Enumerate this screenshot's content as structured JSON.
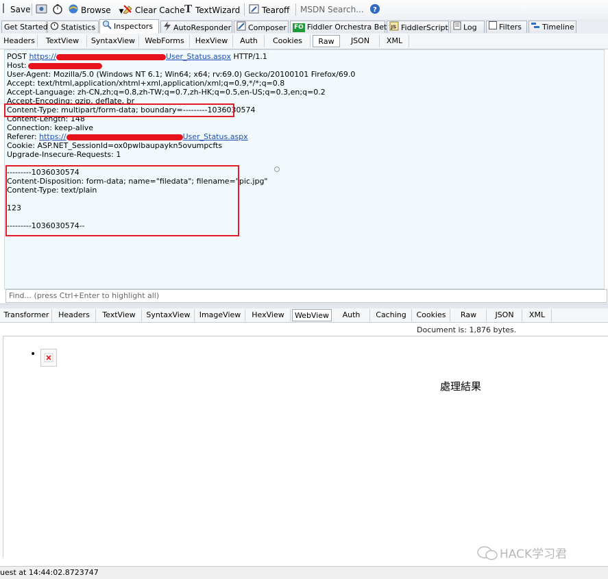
{
  "toolbar": {
    "save": "Save",
    "browse": "Browse",
    "clear_cache": "Clear Cache",
    "text_wizard": "TextWizard",
    "tearoff": "Tearoff",
    "search_placeholder": "MSDN Search..."
  },
  "main_tabs": [
    {
      "label": "Get Started"
    },
    {
      "label": "Statistics"
    },
    {
      "label": "Inspectors",
      "active": true
    },
    {
      "label": "AutoResponder"
    },
    {
      "label": "Composer"
    },
    {
      "label": "Fiddler Orchestra Beta",
      "badge": "FO"
    },
    {
      "label": "FiddlerScript"
    },
    {
      "label": "Log"
    },
    {
      "label": "Filters"
    },
    {
      "label": "Timeline"
    }
  ],
  "request_tabs": [
    "Headers",
    "TextView",
    "SyntaxView",
    "WebForms",
    "HexView",
    "Auth",
    "Cookies",
    "Raw",
    "JSON",
    "XML"
  ],
  "request_active": "Raw",
  "raw": {
    "method": "POST",
    "url_prefix": "https://",
    "url_suffix": "User_Status.aspx",
    "protocol": "HTTP/1.1",
    "host_label": "Host:",
    "user_agent": "User-Agent: Mozilla/5.0 (Windows NT 6.1; Win64; x64; rv:69.0) Gecko/20100101 Firefox/69.0",
    "accept": "Accept: text/html,application/xhtml+xml,application/xml;q=0.9,*/*;q=0.8",
    "accept_language": "Accept-Language: zh-CN,zh;q=0.8,zh-TW;q=0.7,zh-HK;q=0.5,en-US;q=0.3,en;q=0.2",
    "accept_encoding": "Accept-Encoding: gzip, deflate, br",
    "content_type": "Content-Type: multipart/form-data; boundary=---------1036030574",
    "content_length": "Content-Length: 148",
    "connection": "Connection: keep-alive",
    "referer_label": "Referer:",
    "referer_prefix": "https://",
    "referer_suffix": "User_Status.aspx",
    "cookie": "Cookie: ASP.NET_SessionId=ox0pwlbaupaykn5ovumpcfts",
    "upgrade": "Upgrade-Insecure-Requests: 1",
    "body": [
      "---------1036030574",
      "Content-Disposition: form-data; name=\"filedata\"; filename=\"pic.jpg\"",
      "Content-Type: text/plain",
      "",
      "123",
      "",
      "---------1036030574--"
    ]
  },
  "find_placeholder": "Find... (press Ctrl+Enter to highlight all)",
  "response_tabs": [
    "Transformer",
    "Headers",
    "TextView",
    "SyntaxView",
    "ImageView",
    "HexView",
    "WebView",
    "Auth",
    "Caching",
    "Cookies",
    "Raw",
    "JSON",
    "XML"
  ],
  "response_active": "WebView",
  "doc_info": "Document is: 1,876 bytes.",
  "webview": {
    "bullet": "•",
    "heading": "處理結果"
  },
  "watermark": "HACK学习君",
  "status": "uest at 14:44:02.8723747",
  "colors": {
    "redact": "#e8141d",
    "highlight_box": "#e41a26",
    "link": "#1b4fb5",
    "raw_bg": "#f1f9fd"
  }
}
